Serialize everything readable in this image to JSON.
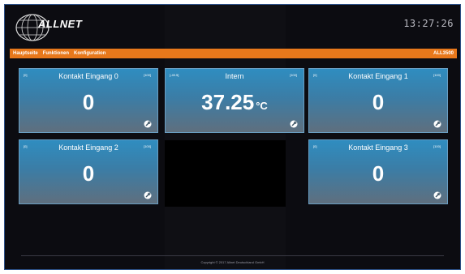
{
  "header": {
    "logo_text": "ALLNET",
    "clock": "13:27:26"
  },
  "menu": {
    "items": [
      "Hauptseite",
      "Funktionen",
      "Konfiguration"
    ],
    "device_name": "ALL3500"
  },
  "tiles": [
    {
      "title": "Kontakt Eingang 0",
      "range_min": "[0]",
      "range_max": "[100]",
      "value": "0",
      "unit": ""
    },
    {
      "title": "Intern",
      "range_min": "[-49.5]",
      "range_max": "[100]",
      "value": "37.25",
      "unit": "°C"
    },
    {
      "title": "Kontakt Eingang 1",
      "range_min": "[0]",
      "range_max": "[100]",
      "value": "0",
      "unit": ""
    },
    {
      "title": "Kontakt Eingang 2",
      "range_min": "[0]",
      "range_max": "[100]",
      "value": "0",
      "unit": ""
    },
    {
      "title": "Kontakt Eingang 3",
      "range_min": "[0]",
      "range_max": "[100]",
      "value": "0",
      "unit": ""
    }
  ],
  "footer": {
    "copyright": "Copyright © 2017 Allnet Deutschland GmbH"
  },
  "colors": {
    "accent_orange": "#e8781b",
    "tile_top": "#2f8dc0",
    "tile_bottom": "#5f6f7e",
    "background": "#0c0c11"
  },
  "icons": [
    "globe-logo-icon",
    "wrench-icon"
  ]
}
